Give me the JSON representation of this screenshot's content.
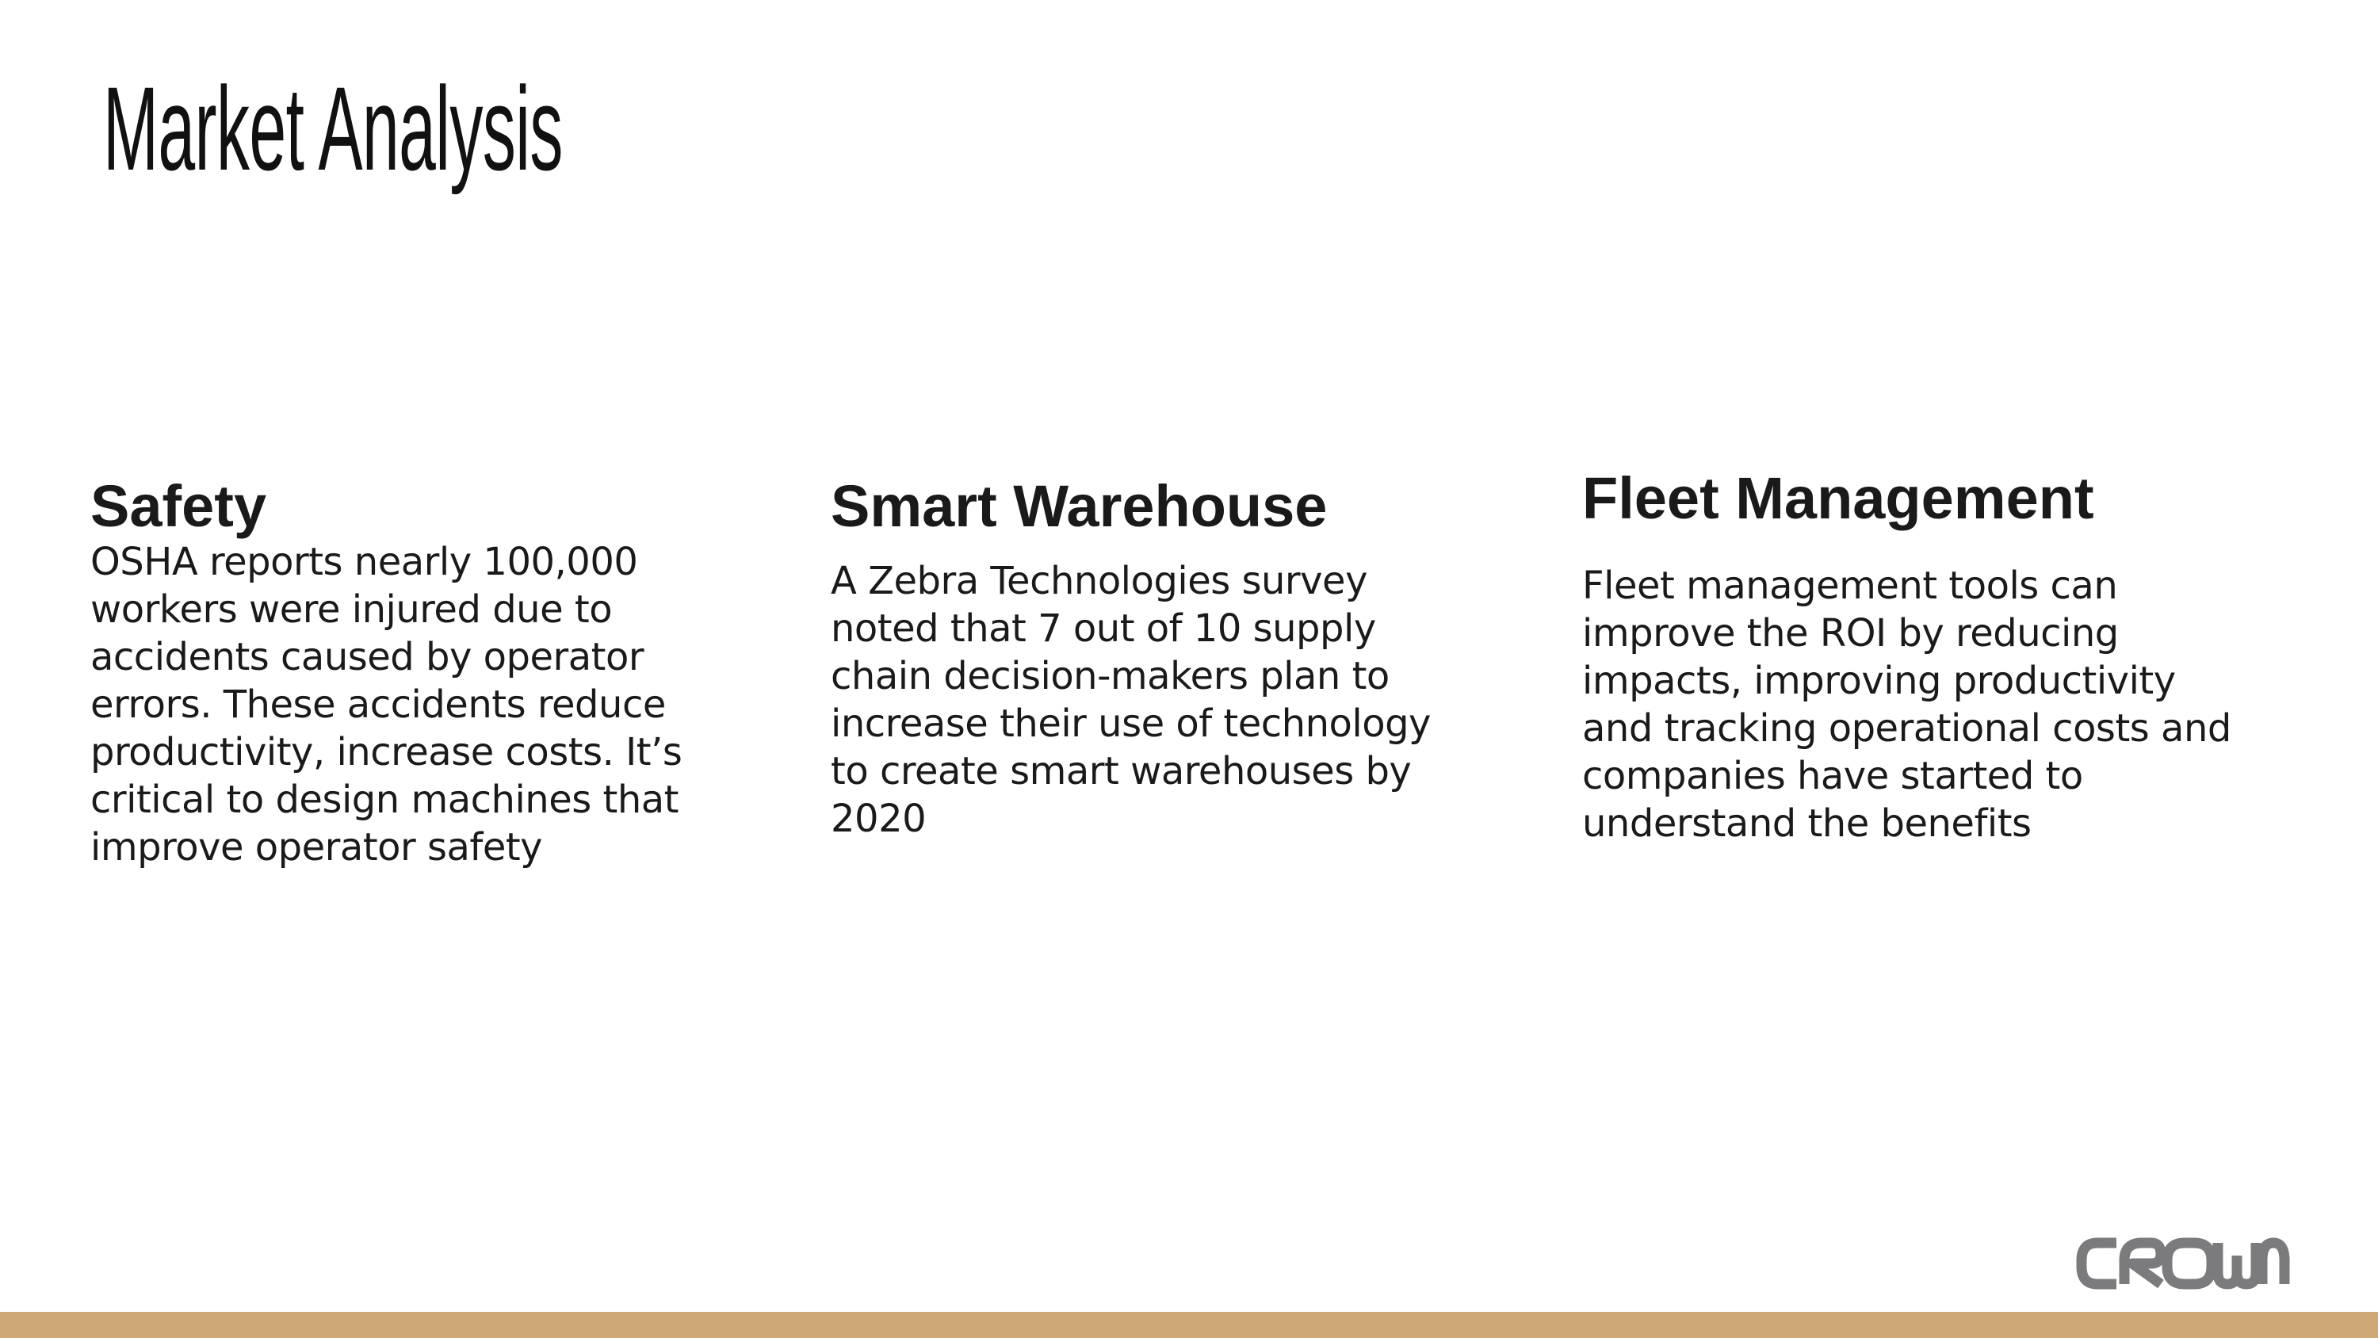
{
  "slide": {
    "title": "Market Analysis",
    "columns": [
      {
        "heading": "Safety",
        "body": "OSHA reports nearly 100,000 workers were injured due to accidents caused by operator errors. These accidents reduce productivity, increase costs. It’s critical to design machines that improve operator safety"
      },
      {
        "heading": "Smart Warehouse",
        "body": "A Zebra Technologies survey noted that 7 out of 10 supply chain decision-makers plan to increase their use of technology to create smart warehouses by 2020"
      },
      {
        "heading": "Fleet Management",
        "body": "Fleet management tools can improve the ROI by reducing impacts, improving productivity and tracking operational costs and companies have started to understand the benefits"
      }
    ],
    "logo": {
      "text": "CROWN",
      "color": "#7b7b7d"
    },
    "bottom_bar_color": "#cfa878"
  }
}
